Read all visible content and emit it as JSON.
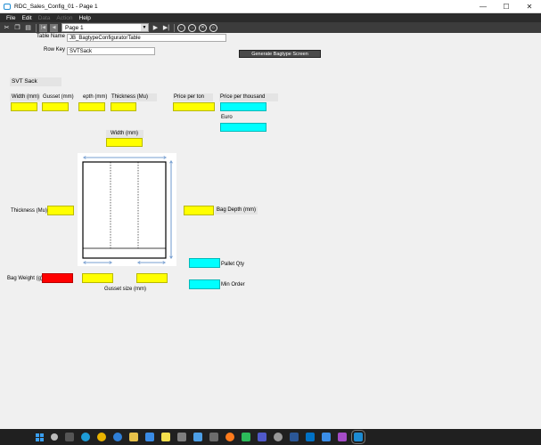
{
  "window": {
    "title": "RDC_Sales_Config_01 - Page 1",
    "controls": {
      "minimize": "—",
      "maximize": "☐",
      "close": "✕"
    }
  },
  "menu": {
    "items": [
      "File",
      "Edit",
      "Data",
      "Action",
      "Help"
    ]
  },
  "toolbar": {
    "page_select_value": "Page 1",
    "icons": [
      "cut-icon",
      "copy-icon",
      "paste-icon",
      "first-page-icon",
      "prev-page-icon",
      "next-page-icon",
      "last-page-icon",
      "back-icon",
      "forward-icon",
      "stop-icon",
      "home-icon"
    ]
  },
  "form": {
    "table_name_label": "Table Name",
    "table_name_value": "JB_BagtypeConfiguratorTable",
    "row_key_label": "Row Key",
    "row_key_value": "SVTSack",
    "generate_button": "Generate Bagtype Screen",
    "section_title": "SVT Sack",
    "col_width": "Width (mm)",
    "col_gusset": "Gusset (mm)",
    "col_depth": "epth (mm)",
    "col_thickness": "Thickness (Mu)",
    "col_price_ton": "Price per ton",
    "col_price_thousand": "Price per thousand",
    "euro_label": "Euro",
    "diagram_width_label": "Width (mm)",
    "thickness_label": "Thickness (Mu)",
    "bag_depth_label": "Bag Depth (mm)",
    "bag_weight_label": "Bag Weight (g)",
    "gusset_size_label": "Gusset size (mm)",
    "pallet_qty_label": "Pallet Qty",
    "min_order_label": "Min Order"
  },
  "colors": {
    "input_yellow": "#ffff00",
    "output_cyan": "#00ffff",
    "weight_red": "#ff0000",
    "diagram_arrows": "#4a7fc1"
  },
  "taskbar": {
    "icons": [
      "windows-start-icon",
      "search-icon",
      "task-view-icon",
      "edge-icon",
      "chrome-icon",
      "maps-icon",
      "file-explorer-icon",
      "store-icon",
      "notes-icon",
      "files-icon",
      "app-icon",
      "app-icon-2",
      "firefox-icon",
      "vpn-icon",
      "teams-icon",
      "app-icon-3",
      "word-icon",
      "outlook-icon",
      "calendar-icon",
      "music-icon",
      "rdc-app-icon"
    ]
  }
}
